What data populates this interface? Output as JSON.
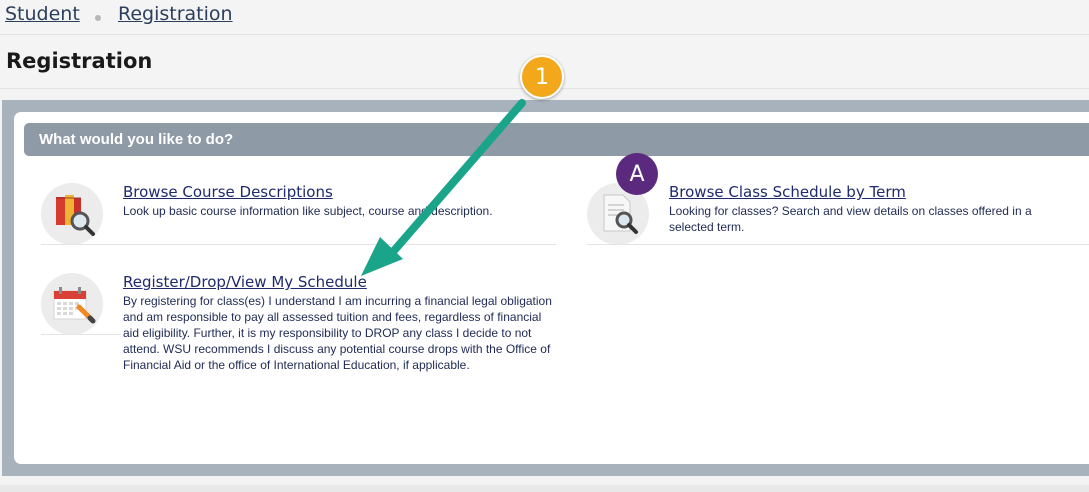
{
  "breadcrumb": {
    "items": [
      {
        "label": "Student"
      },
      {
        "label": "Registration"
      }
    ]
  },
  "page": {
    "title": "Registration"
  },
  "panel": {
    "prompt": "What would you like to do?",
    "options": [
      {
        "title": "Browse Course Descriptions",
        "description": "Look up basic course information like subject, course and description.",
        "icon": "books-magnifier-icon"
      },
      {
        "title": "Browse Class Schedule by Term",
        "description": "Looking for classes? Search and view details on classes offered in a selected term.",
        "icon": "document-magnifier-icon"
      },
      {
        "title": "Register/Drop/View My Schedule",
        "description": "By registering for class(es) I understand I am incurring a financial legal obligation and am responsible to pay all assessed tuition and fees, regardless of financial aid eligibility. Further, it is my responsibility to DROP any class I decide to not attend. WSU recommends I discuss any potential course drops with the Office of Financial Aid or the office of International Education, if applicable.",
        "icon": "calendar-pencil-icon"
      }
    ]
  },
  "annotations": {
    "step_badge": "1",
    "letter_badge": "A",
    "colors": {
      "step_badge": "#f3a71b",
      "letter_badge": "#5b2a7e",
      "arrow": "#1aa58a"
    }
  }
}
